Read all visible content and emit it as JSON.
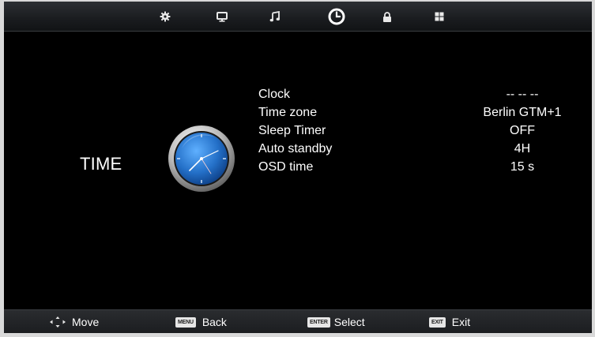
{
  "tabs": [
    {
      "id": "picture",
      "icon": "settings-gear-icon",
      "active": false
    },
    {
      "id": "screen",
      "icon": "monitor-icon",
      "active": false
    },
    {
      "id": "sound",
      "icon": "music-note-icon",
      "active": false
    },
    {
      "id": "time",
      "icon": "clock-icon",
      "active": true
    },
    {
      "id": "lock",
      "icon": "lock-icon",
      "active": false
    },
    {
      "id": "setup",
      "icon": "grid-icon",
      "active": false
    }
  ],
  "section": {
    "title": "TIME",
    "icon": "analog-clock-icon"
  },
  "menu": [
    {
      "label": "Clock",
      "value": "-- -- --"
    },
    {
      "label": "Time zone",
      "value": "Berlin GTM+1"
    },
    {
      "label": "Sleep Timer",
      "value": "OFF"
    },
    {
      "label": "Auto standby",
      "value": "4H"
    },
    {
      "label": "OSD time",
      "value": "15 s"
    }
  ],
  "footer": {
    "move": {
      "icon": "dpad-arrows-icon",
      "label": "Move"
    },
    "back": {
      "key": "MENU",
      "label": "Back"
    },
    "select": {
      "key": "ENTER",
      "label": "Select"
    },
    "exit": {
      "key": "EXIT",
      "label": "Exit"
    }
  },
  "colors": {
    "accent_blue": "#2f7fd6",
    "background": "#000000",
    "text": "#ffffff"
  }
}
